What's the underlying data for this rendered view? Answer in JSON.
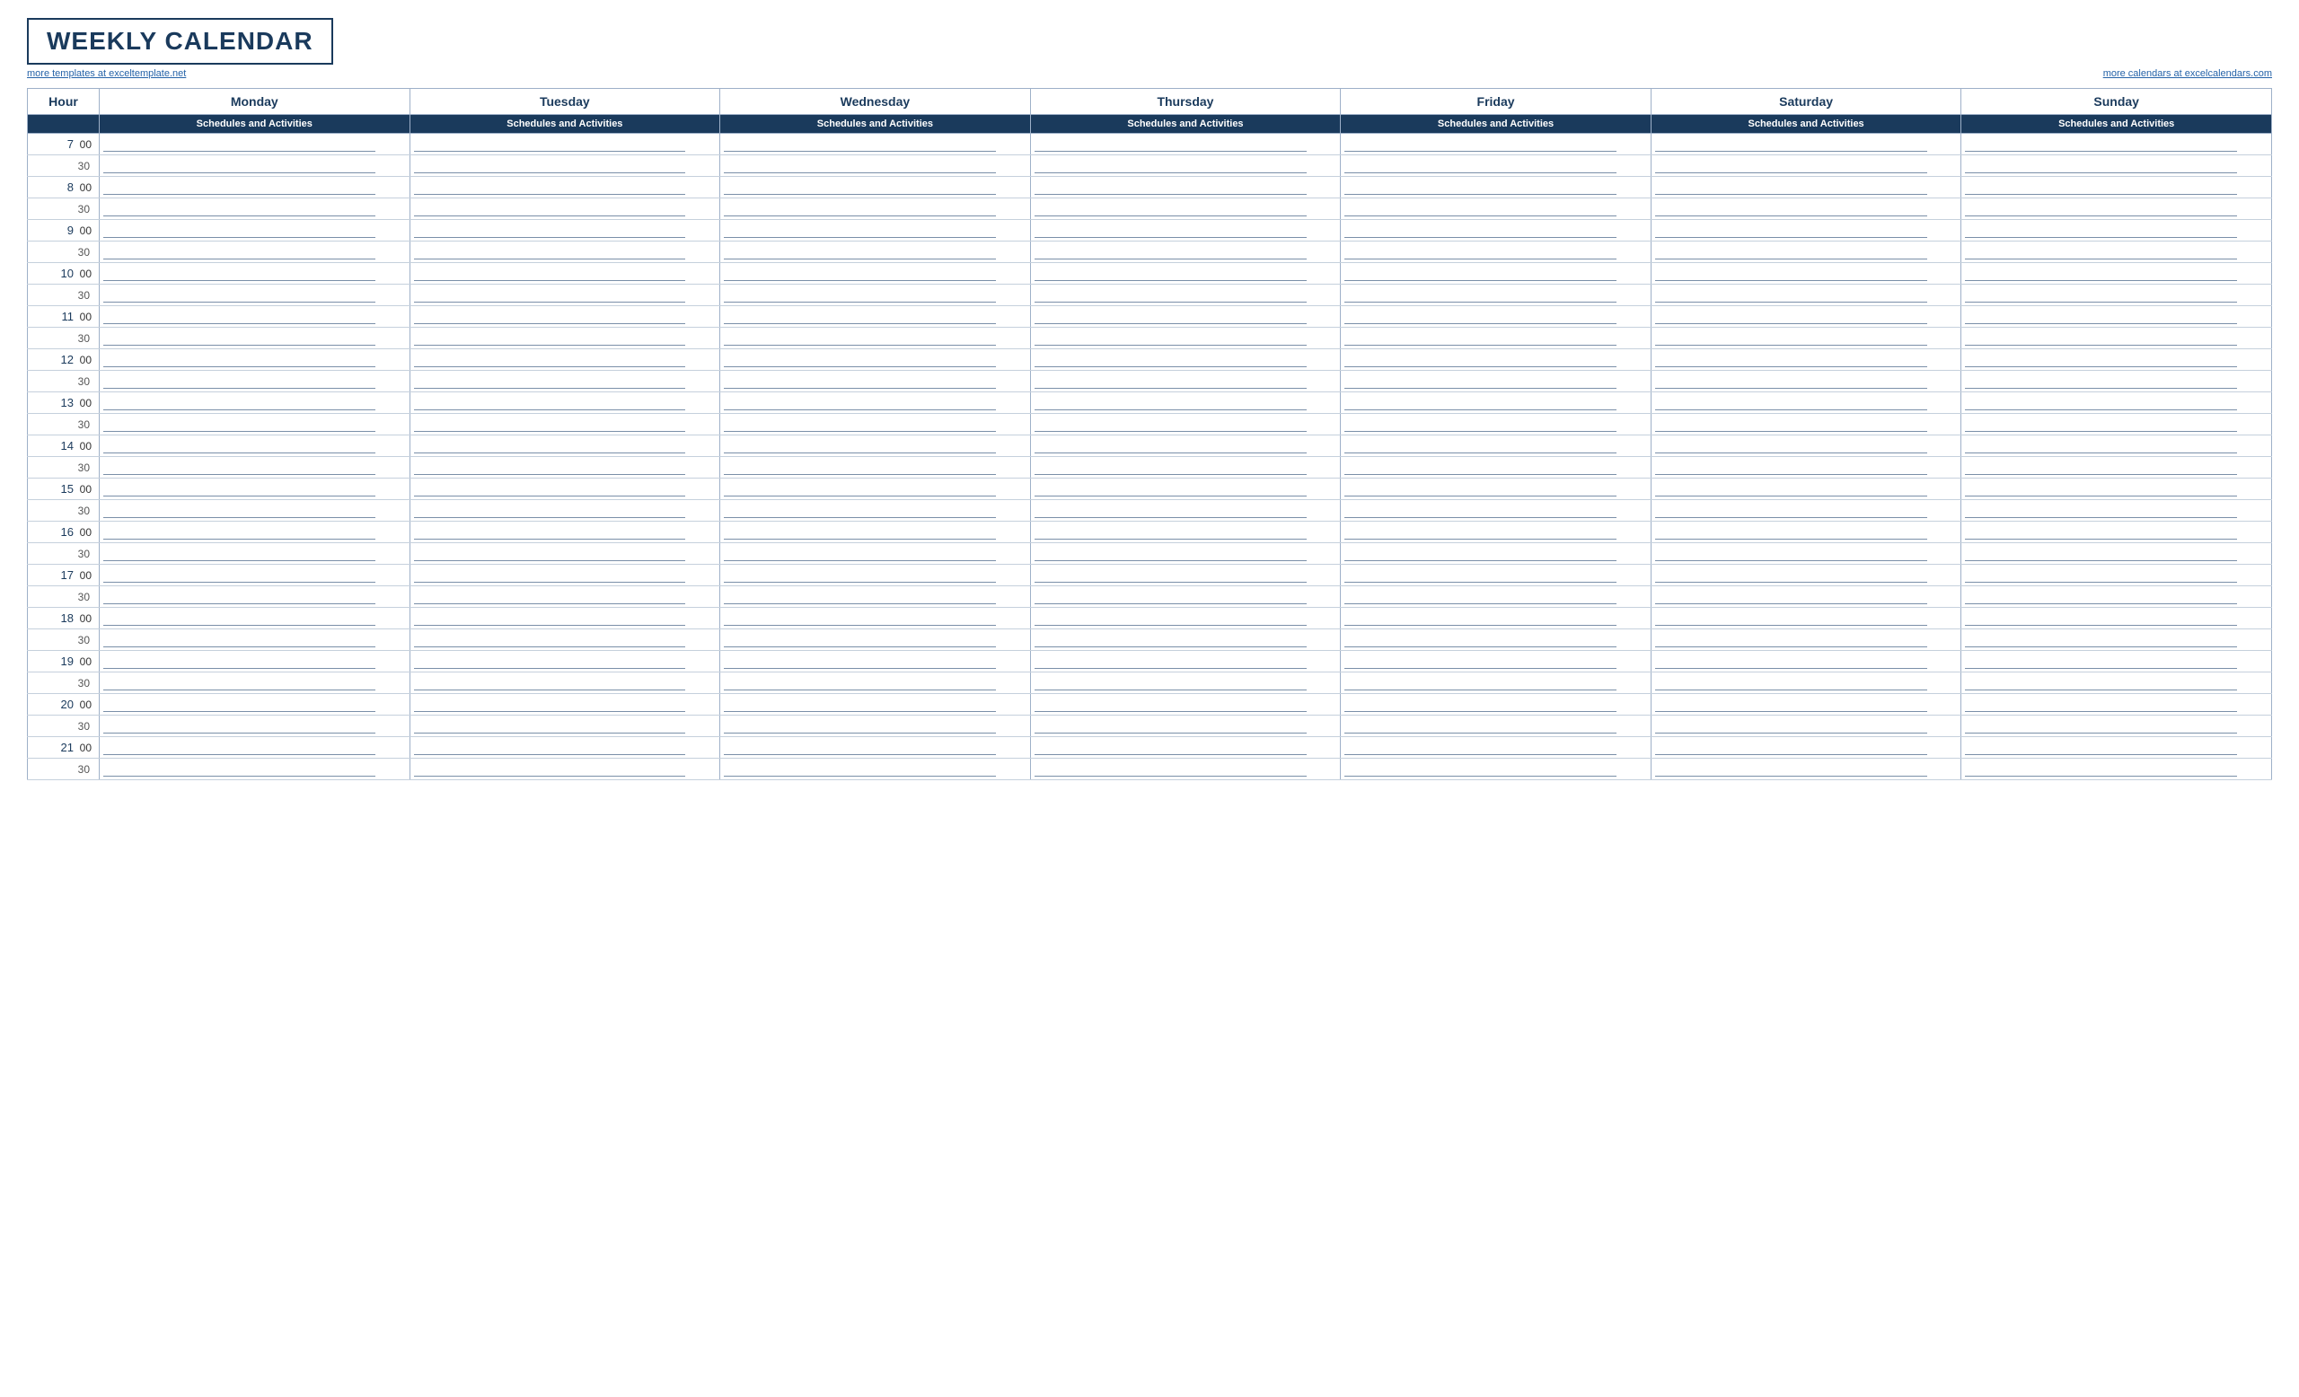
{
  "title": "WEEKLY CALENDAR",
  "link_left": "more templates at exceltemplate.net",
  "link_right": "more calendars at excelcalendars.com",
  "hour_label": "Hour",
  "sub_label": "Schedules and Activities",
  "days": [
    "Monday",
    "Tuesday",
    "Wednesday",
    "Thursday",
    "Friday",
    "Saturday",
    "Sunday"
  ],
  "hours": [
    {
      "hour": "7",
      "min": "00"
    },
    {
      "hour": "",
      "min": "30"
    },
    {
      "hour": "8",
      "min": "00"
    },
    {
      "hour": "",
      "min": "30"
    },
    {
      "hour": "9",
      "min": "00"
    },
    {
      "hour": "",
      "min": "30"
    },
    {
      "hour": "10",
      "min": "00"
    },
    {
      "hour": "",
      "min": "30"
    },
    {
      "hour": "11",
      "min": "00"
    },
    {
      "hour": "",
      "min": "30"
    },
    {
      "hour": "12",
      "min": "00"
    },
    {
      "hour": "",
      "min": "30"
    },
    {
      "hour": "13",
      "min": "00"
    },
    {
      "hour": "",
      "min": "30"
    },
    {
      "hour": "14",
      "min": "00"
    },
    {
      "hour": "",
      "min": "30"
    },
    {
      "hour": "15",
      "min": "00"
    },
    {
      "hour": "",
      "min": "30"
    },
    {
      "hour": "16",
      "min": "00"
    },
    {
      "hour": "",
      "min": "30"
    },
    {
      "hour": "17",
      "min": "00"
    },
    {
      "hour": "",
      "min": "30"
    },
    {
      "hour": "18",
      "min": "00"
    },
    {
      "hour": "",
      "min": "30"
    },
    {
      "hour": "19",
      "min": "00"
    },
    {
      "hour": "",
      "min": "30"
    },
    {
      "hour": "20",
      "min": "00"
    },
    {
      "hour": "",
      "min": "30"
    },
    {
      "hour": "21",
      "min": "00"
    },
    {
      "hour": "",
      "min": "30"
    }
  ]
}
